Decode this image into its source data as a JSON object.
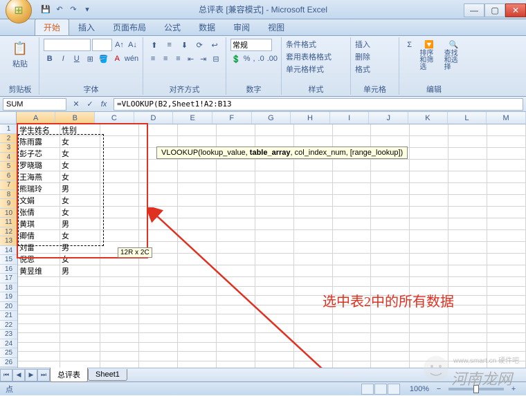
{
  "title": "总评表 [兼容模式] - Microsoft Excel",
  "tabs": [
    "开始",
    "插入",
    "页面布局",
    "公式",
    "数据",
    "审阅",
    "视图"
  ],
  "ribbon": {
    "clipboard": {
      "paste": "粘贴",
      "label": "剪贴板"
    },
    "font": {
      "label": "字体"
    },
    "align": {
      "label": "对齐方式"
    },
    "number": {
      "combo": "常规",
      "label": "数字"
    },
    "styles": {
      "cond": "条件格式",
      "table": "套用表格格式",
      "cell": "单元格样式",
      "label": "样式"
    },
    "cells": {
      "insert": "插入",
      "delete": "删除",
      "format": "格式",
      "label": "单元格"
    },
    "editing": {
      "sort": "排序和筛选",
      "find": "查找和选择",
      "label": "编辑"
    }
  },
  "namebox": "SUM",
  "formula": "=VLOOKUP(B2,Sheet1!A2:B13",
  "tooltip_parts": [
    "VLOOKUP(lookup_value, ",
    "table_array",
    ", col_index_num, [range_lookup])"
  ],
  "size_hint": "12R x 2C",
  "columns": [
    "A",
    "B",
    "C",
    "D",
    "E",
    "F",
    "G",
    "H",
    "I",
    "J",
    "K",
    "L",
    "M"
  ],
  "data_rows": [
    [
      "学生姓名",
      "性别",
      ""
    ],
    [
      "陈雨露",
      "女",
      ""
    ],
    [
      "彭子芯",
      "女",
      ""
    ],
    [
      "罗晓璐",
      "女",
      ""
    ],
    [
      "王海燕",
      "女",
      ""
    ],
    [
      "熊瑞玲",
      "男",
      ""
    ],
    [
      "文娟",
      "女",
      ""
    ],
    [
      "张倩",
      "女",
      ""
    ],
    [
      "黄琪",
      "男",
      ""
    ],
    [
      "卿倩",
      "女",
      ""
    ],
    [
      "刘雷",
      "男",
      ""
    ],
    [
      "倪思",
      "女",
      ""
    ],
    [
      "黄昱维",
      "男",
      ""
    ]
  ],
  "total_rows": 26,
  "sheets": [
    "总评表",
    "Sheet1"
  ],
  "status": "点",
  "zoom": "100%",
  "annotation": "选中表2中的所有数据",
  "watermark": "河南龙网"
}
